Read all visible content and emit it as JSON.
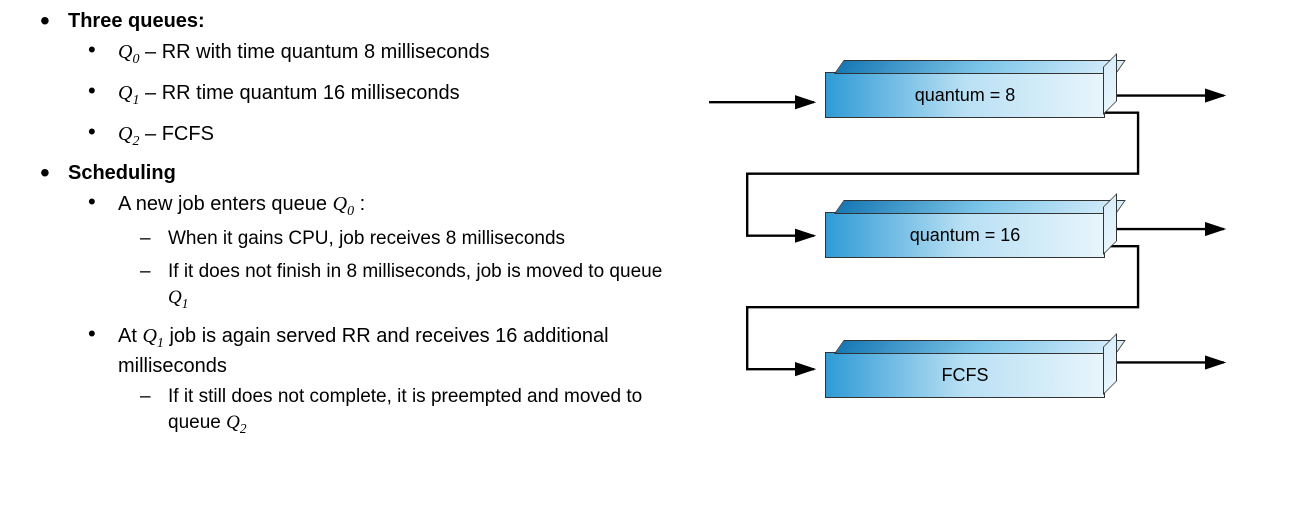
{
  "headings": {
    "three_queues": "Three queues:",
    "scheduling": "Scheduling"
  },
  "queues": {
    "q0": {
      "name": "Q",
      "sub": "0",
      "desc": " – RR with time quantum 8 milliseconds"
    },
    "q1": {
      "name": "Q",
      "sub": "1",
      "desc": " – RR time quantum 16 milliseconds"
    },
    "q2": {
      "name": "Q",
      "sub": "2",
      "desc": " – FCFS"
    }
  },
  "scheduling": {
    "new_job_pre": "A new job enters queue ",
    "new_job_q": "Q",
    "new_job_sub": "0",
    "new_job_post": " :",
    "dash_gain": "When it gains CPU, job receives 8 milliseconds",
    "dash_not_finish_pre": "If it does not finish in 8 milliseconds, job is moved to queue ",
    "dash_not_finish_q": "Q",
    "dash_not_finish_sub": "1",
    "at_q1_pre": "At ",
    "at_q1_q": "Q",
    "at_q1_sub": "1",
    "at_q1_post": " job is again served RR and receives 16 additional milliseconds",
    "dash_still_pre": "If it still does not complete, it is preempted and moved to queue ",
    "dash_still_q": "Q",
    "dash_still_sub": "2"
  },
  "diagram": {
    "box1": "quantum = 8",
    "box2": "quantum = 16",
    "box3": "FCFS"
  }
}
